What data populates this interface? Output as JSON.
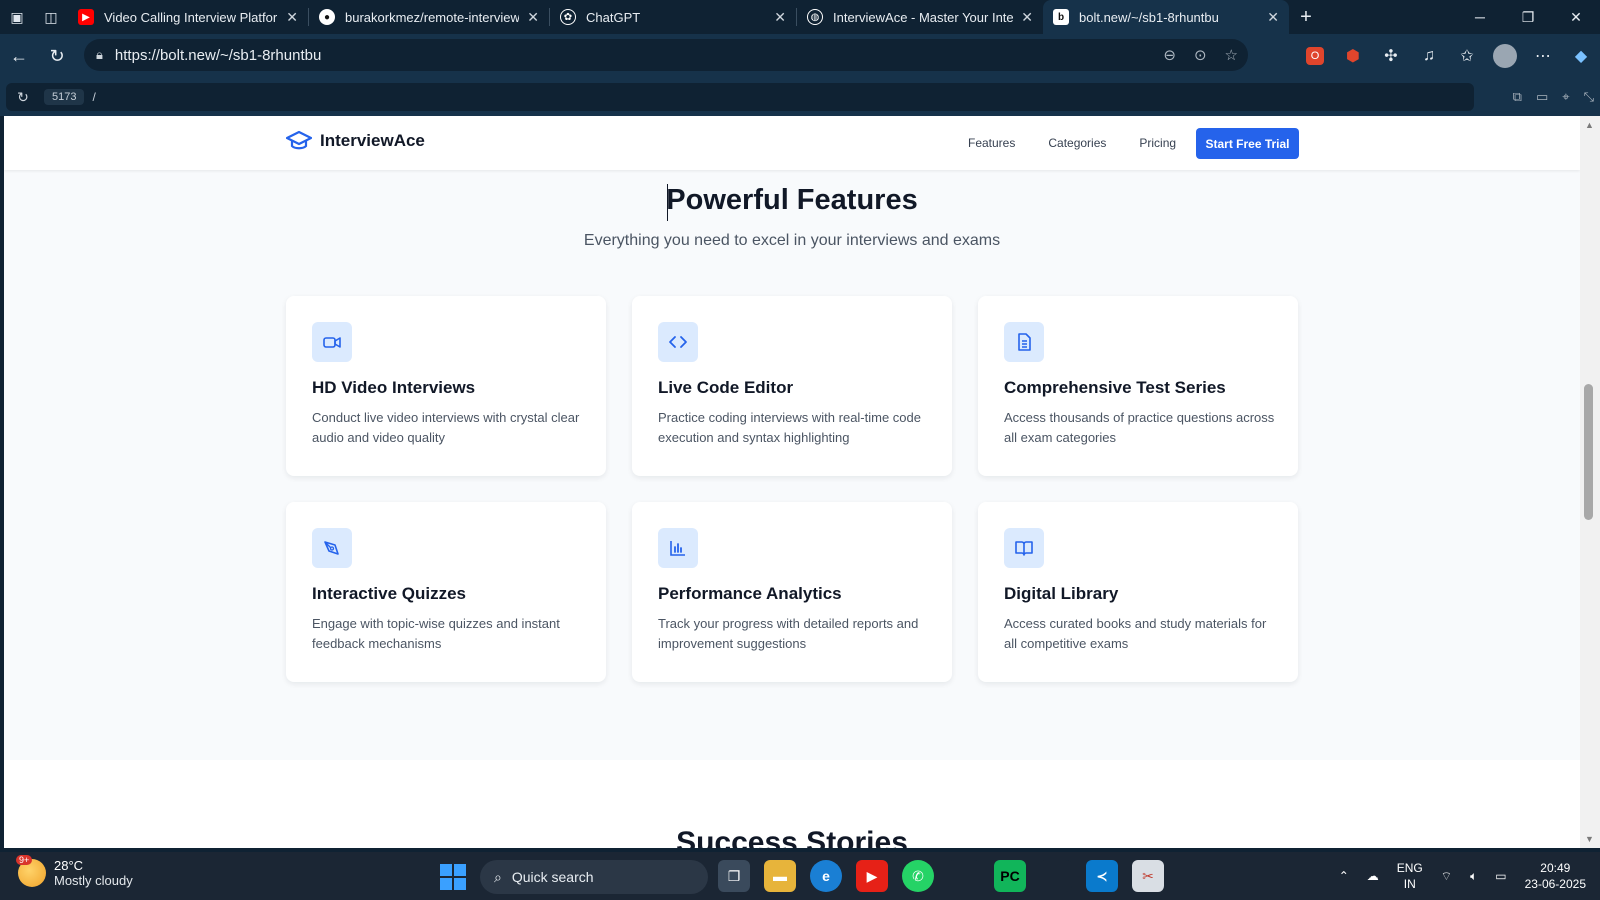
{
  "browser": {
    "tabs": [
      {
        "title": "Video Calling Interview Platform: I",
        "favicon": "youtube-icon",
        "color": "#ff0000"
      },
      {
        "title": "burakorkmez/remote-interview-p",
        "favicon": "github-icon",
        "color": "#ffffff"
      },
      {
        "title": "ChatGPT",
        "favicon": "chatgpt-icon",
        "color": "#ffffff"
      },
      {
        "title": "InterviewAce - Master Your Interv",
        "favicon": "globe-icon",
        "color": "#ffffff"
      },
      {
        "title": "bolt.new/~/sb1-8rhuntbu",
        "favicon": "bolt-icon",
        "color": "#ffffff"
      }
    ],
    "address": "https://bolt.new/~/sb1-8rhuntbu",
    "preview_port": "5173",
    "preview_path": "/"
  },
  "site": {
    "brand": "InterviewAce",
    "nav": [
      "Features",
      "Categories",
      "Pricing"
    ],
    "cta": "Start Free Trial",
    "accent": "#2563eb"
  },
  "features": {
    "title": "Powerful Features",
    "subtitle": "Everything you need to excel in your interviews and exams",
    "cards": [
      {
        "icon": "video-icon",
        "title": "HD Video Interviews",
        "desc": "Conduct live video interviews with crystal clear audio and video quality"
      },
      {
        "icon": "code-icon",
        "title": "Live Code Editor",
        "desc": "Practice coding interviews with real-time code execution and syntax highlighting"
      },
      {
        "icon": "document-icon",
        "title": "Comprehensive Test Series",
        "desc": "Access thousands of practice questions across all exam categories"
      },
      {
        "icon": "pen-tool-icon",
        "title": "Interactive Quizzes",
        "desc": "Engage with topic-wise quizzes and instant feedback mechanisms"
      },
      {
        "icon": "bar-chart-icon",
        "title": "Performance Analytics",
        "desc": "Track your progress with detailed reports and improvement suggestions"
      },
      {
        "icon": "book-open-icon",
        "title": "Digital Library",
        "desc": "Access curated books and study materials for all competitive exams"
      }
    ]
  },
  "stories": {
    "title": "Success Stories"
  },
  "taskbar": {
    "weather_temp": "28°C",
    "weather_desc": "Mostly cloudy",
    "weather_badge": "9+",
    "search_placeholder": "Quick search",
    "lang_line1": "ENG",
    "lang_line2": "IN",
    "time": "20:49",
    "date": "23-06-2025"
  }
}
